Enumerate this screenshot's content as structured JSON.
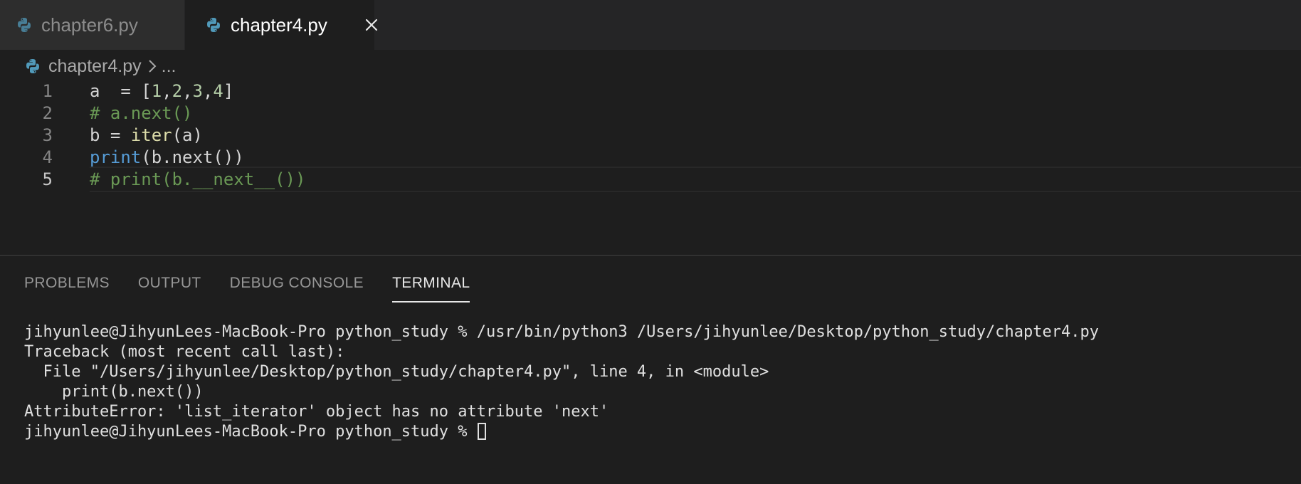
{
  "tabs": [
    {
      "label": "chapter6.py",
      "active": false
    },
    {
      "label": "chapter4.py",
      "active": true
    }
  ],
  "breadcrumb": {
    "file": "chapter4.py",
    "more": "..."
  },
  "editor": {
    "lines": [
      {
        "num": "1",
        "tokens": [
          {
            "t": "a  = [",
            "c": "plain"
          },
          {
            "t": "1",
            "c": "num"
          },
          {
            "t": ",",
            "c": "plain"
          },
          {
            "t": "2",
            "c": "num"
          },
          {
            "t": ",",
            "c": "plain"
          },
          {
            "t": "3",
            "c": "num"
          },
          {
            "t": ",",
            "c": "plain"
          },
          {
            "t": "4",
            "c": "num"
          },
          {
            "t": "]",
            "c": "plain"
          }
        ]
      },
      {
        "num": "2",
        "tokens": [
          {
            "t": "# a.next()",
            "c": "comment"
          }
        ]
      },
      {
        "num": "3",
        "tokens": [
          {
            "t": "b = ",
            "c": "plain"
          },
          {
            "t": "iter",
            "c": "builtin"
          },
          {
            "t": "(a)",
            "c": "plain"
          }
        ]
      },
      {
        "num": "4",
        "tokens": [
          {
            "t": "print",
            "c": "func"
          },
          {
            "t": "(b.next())",
            "c": "plain"
          }
        ]
      },
      {
        "num": "5",
        "tokens": [
          {
            "t": "# print(b.__next__())",
            "c": "comment"
          }
        ]
      }
    ],
    "current_line": 5
  },
  "panel": {
    "tabs": [
      {
        "label": "PROBLEMS",
        "active": false
      },
      {
        "label": "OUTPUT",
        "active": false
      },
      {
        "label": "DEBUG CONSOLE",
        "active": false
      },
      {
        "label": "TERMINAL",
        "active": true
      }
    ]
  },
  "terminal": {
    "lines": [
      "jihyunlee@JihyunLees-MacBook-Pro python_study % /usr/bin/python3 /Users/jihyunlee/Desktop/python_study/chapter4.py",
      "Traceback (most recent call last):",
      "  File \"/Users/jihyunlee/Desktop/python_study/chapter4.py\", line 4, in <module>",
      "    print(b.next())",
      "AttributeError: 'list_iterator' object has no attribute 'next'"
    ],
    "prompt": "jihyunlee@JihyunLees-MacBook-Pro python_study % "
  },
  "colors": {
    "background": "#1e1e1e",
    "python_icon_blue": "#519aba",
    "comment": "#6a9955",
    "number": "#b5cea8",
    "builtin": "#dcdcaa",
    "keyword_func": "#569cd6"
  },
  "icons": {
    "file_type": "python-file-icon",
    "close": "close-icon",
    "chevron": "chevron-right-icon"
  }
}
